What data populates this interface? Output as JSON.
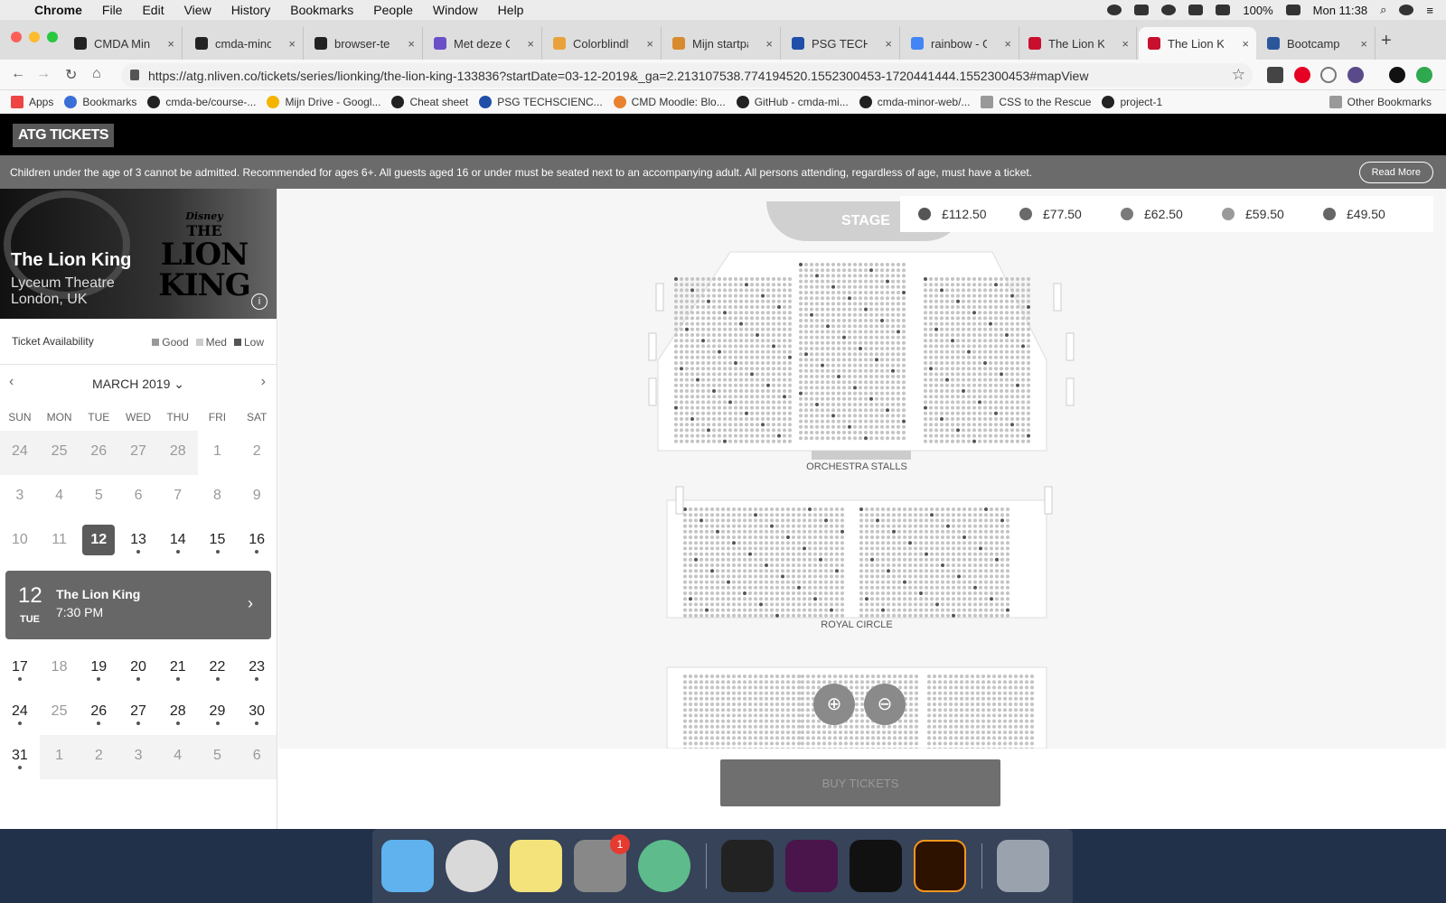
{
  "menubar": {
    "app": "Chrome",
    "items": [
      "File",
      "Edit",
      "View",
      "History",
      "Bookmarks",
      "People",
      "Window",
      "Help"
    ],
    "battery": "100%",
    "clock": "Mon 11:38"
  },
  "tabs": [
    {
      "title": "CMDA Minor",
      "icon": "github-icon"
    },
    {
      "title": "cmda-minor-",
      "icon": "github-icon"
    },
    {
      "title": "browser-tech",
      "icon": "github-icon"
    },
    {
      "title": "Met deze Ch",
      "icon": "app-icon"
    },
    {
      "title": "Colorblindly",
      "icon": "rainbow-icon"
    },
    {
      "title": "Mijn startpag",
      "icon": "page-icon"
    },
    {
      "title": "PSG TECHSC",
      "icon": "psg-icon"
    },
    {
      "title": "rainbow - Go",
      "icon": "google-icon"
    },
    {
      "title": "The Lion Kin",
      "icon": "atg-icon"
    },
    {
      "title": "The Lion Kin",
      "icon": "atg-icon"
    },
    {
      "title": "Bootcamp ci",
      "icon": "word-icon"
    }
  ],
  "address": "https://atg.nliven.co/tickets/series/lionking/the-lion-king-133836?startDate=03-12-2019&_ga=2.213107538.774194520.1552300453-1720441444.1552300453#mapView",
  "bookmarks": [
    "Apps",
    "Bookmarks",
    "cmda-be/course-...",
    "Mijn Drive - Googl...",
    "Cheat sheet",
    "PSG TECHSCIENC...",
    "CMD Moodle: Blo...",
    "GitHub - cmda-mi...",
    "cmda-minor-web/...",
    "CSS to the Rescue",
    "project-1"
  ],
  "other_bookmarks": "Other Bookmarks",
  "site": {
    "logo": "ATG TICKETS",
    "notice": "Children under the age of 3 cannot be admitted. Recommended for ages 6+. All guests aged 16 or under must be seated next to an accompanying adult. All persons attending, regardless of age, must have a ticket.",
    "read_more": "Read More",
    "hero": {
      "disney": "Disney",
      "the": "THE",
      "lionking": "LION KING",
      "show": "The Lion King",
      "venue": "Lyceum Theatre",
      "city": "London, UK",
      "info": "i"
    },
    "availability": {
      "label": "Ticket Availability",
      "good": "Good",
      "med": "Med",
      "low": "Low"
    },
    "month": "MARCH 2019",
    "dows": [
      "SUN",
      "MON",
      "TUE",
      "WED",
      "THU",
      "FRI",
      "SAT"
    ],
    "weeks_top": [
      [
        "24",
        "25",
        "26",
        "27",
        "28",
        "1",
        "2"
      ],
      [
        "3",
        "4",
        "5",
        "6",
        "7",
        "8",
        "9"
      ],
      [
        "10",
        "11",
        "12",
        "13",
        "14",
        "15",
        "16"
      ]
    ],
    "weeks_bottom": [
      [
        "17",
        "18",
        "19",
        "20",
        "21",
        "22",
        "23"
      ],
      [
        "24",
        "25",
        "26",
        "27",
        "28",
        "29",
        "30"
      ],
      [
        "31",
        "1",
        "2",
        "3",
        "4",
        "5",
        "6"
      ]
    ],
    "event": {
      "day": "12",
      "dow": "TUE",
      "name": "The Lion King",
      "time": "7:30 PM"
    },
    "prices": [
      {
        "label": "£112.50",
        "color": "#555555"
      },
      {
        "label": "£77.50",
        "color": "#6a6a6a"
      },
      {
        "label": "£62.50",
        "color": "#7a7a7a"
      },
      {
        "label": "£59.50",
        "color": "#9a9a9a"
      },
      {
        "label": "£49.50",
        "color": "#666666"
      }
    ],
    "stage": "STAGE",
    "section1": "ORCHESTRA STALLS",
    "section2": "ROYAL CIRCLE",
    "buy": "BUY TICKETS"
  },
  "dock_badge": "1"
}
